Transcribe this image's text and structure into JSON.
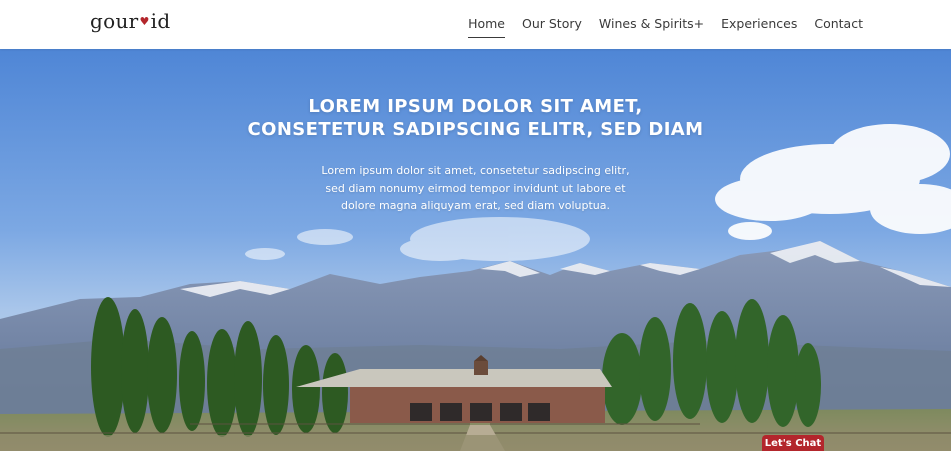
{
  "brand": {
    "logo_prefix": "gour",
    "logo_suffix": "id",
    "heart_glyph": "♥",
    "accent_color": "#b3262c"
  },
  "nav": {
    "items": [
      "Home",
      "Our Story",
      "Wines & Spirits+",
      "Experiences",
      "Contact"
    ],
    "active": "Home"
  },
  "hero": {
    "title_line1": "LOREM IPSUM DOLOR SIT AMET,",
    "title_line2": "CONSETETUR SADIPSCING ELITR, SED DIAM",
    "text_line1": "Lorem ipsum dolor sit amet, consetetur sadipscing elitr,",
    "text_line2": "sed diam nonumy eirmod tempor invidunt ut labore et",
    "text_line3": "dolore magna aliquyam erat, sed diam voluptua."
  },
  "chat": {
    "label": "Let's Chat"
  }
}
